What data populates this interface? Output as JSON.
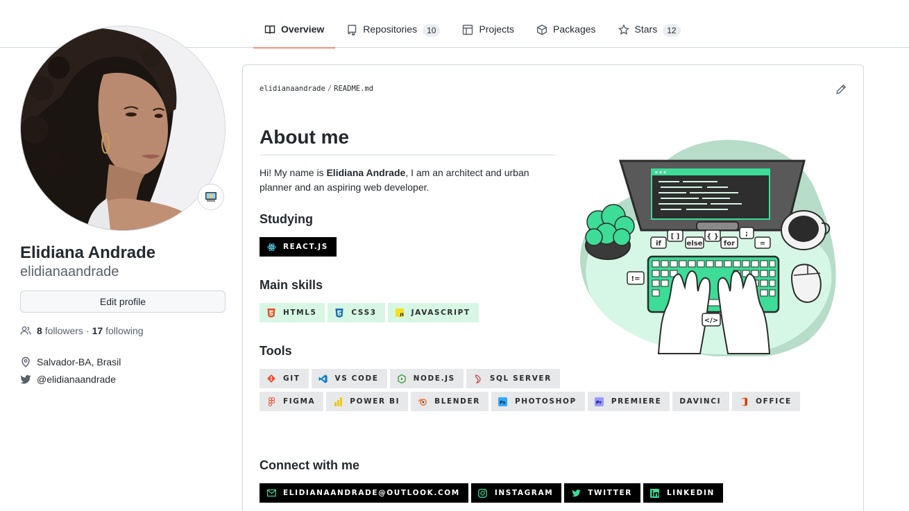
{
  "nav": {
    "tabs": [
      {
        "label": "Overview",
        "icon": "book-icon",
        "active": true
      },
      {
        "label": "Repositories",
        "icon": "repo-icon",
        "count": "10"
      },
      {
        "label": "Projects",
        "icon": "table-icon"
      },
      {
        "label": "Packages",
        "icon": "package-icon"
      },
      {
        "label": "Stars",
        "icon": "star-icon",
        "count": "12"
      }
    ]
  },
  "profile": {
    "full_name": "Elidiana Andrade",
    "username": "elidianaandrade",
    "edit_label": "Edit profile",
    "followers_count": "8",
    "followers_label": "followers",
    "separator": "·",
    "following_count": "17",
    "following_label": "following",
    "location": "Salvador-BA, Brasil",
    "twitter": "@elidianaandrade",
    "status_emoji": "computer-emoji"
  },
  "readme": {
    "owner": "elidianaandrade",
    "separator": "/",
    "file": "README.md",
    "title": "About me",
    "intro_prefix": "Hi! My name is ",
    "intro_name": "Elidiana Andrade",
    "intro_suffix": ", I am an architect and urban planner and an aspiring web developer.",
    "sections": {
      "studying": "Studying",
      "main_skills": "Main skills",
      "tools": "Tools",
      "connect": "Connect with me"
    },
    "studying_badges": [
      {
        "label": "REACT.JS",
        "icon": "react-icon"
      }
    ],
    "skill_badges": [
      {
        "label": "HTML5",
        "icon": "html5-icon"
      },
      {
        "label": "CSS3",
        "icon": "css3-icon"
      },
      {
        "label": "JAVASCRIPT",
        "icon": "javascript-icon"
      }
    ],
    "tool_badges_row1": [
      {
        "label": "GIT",
        "icon": "git-icon"
      },
      {
        "label": "VS CODE",
        "icon": "vscode-icon"
      },
      {
        "label": "NODE.JS",
        "icon": "nodejs-icon"
      },
      {
        "label": "SQL SERVER",
        "icon": "sqlserver-icon"
      }
    ],
    "tool_badges_row2": [
      {
        "label": "FIGMA",
        "icon": "figma-icon"
      },
      {
        "label": "POWER BI",
        "icon": "powerbi-icon"
      },
      {
        "label": "BLENDER",
        "icon": "blender-icon"
      },
      {
        "label": "PHOTOSHOP",
        "icon": "photoshop-icon"
      },
      {
        "label": "PREMIERE",
        "icon": "premiere-icon"
      },
      {
        "label": "DAVINCI",
        "icon": ""
      },
      {
        "label": "OFFICE",
        "icon": "office-icon"
      }
    ],
    "connect_badges": [
      {
        "label": "ELIDIANAANDRADE@OUTLOOK.COM",
        "icon": "mail-icon"
      },
      {
        "label": "INSTAGRAM",
        "icon": "instagram-icon"
      },
      {
        "label": "TWITTER",
        "icon": "twitter-icon"
      },
      {
        "label": "LINKEDIN",
        "icon": "linkedin-icon"
      }
    ],
    "illustration_keys": [
      "[ ]",
      "{ }",
      ";",
      "if",
      "else",
      "for",
      "=",
      "!=",
      "</>"
    ]
  },
  "colors": {
    "accent_underline": "#fd8c73",
    "badge_dark": "#000000",
    "badge_green": "#d7f7e4",
    "badge_grey": "#e6e8ea",
    "illustration_green": "#3ddc97"
  }
}
